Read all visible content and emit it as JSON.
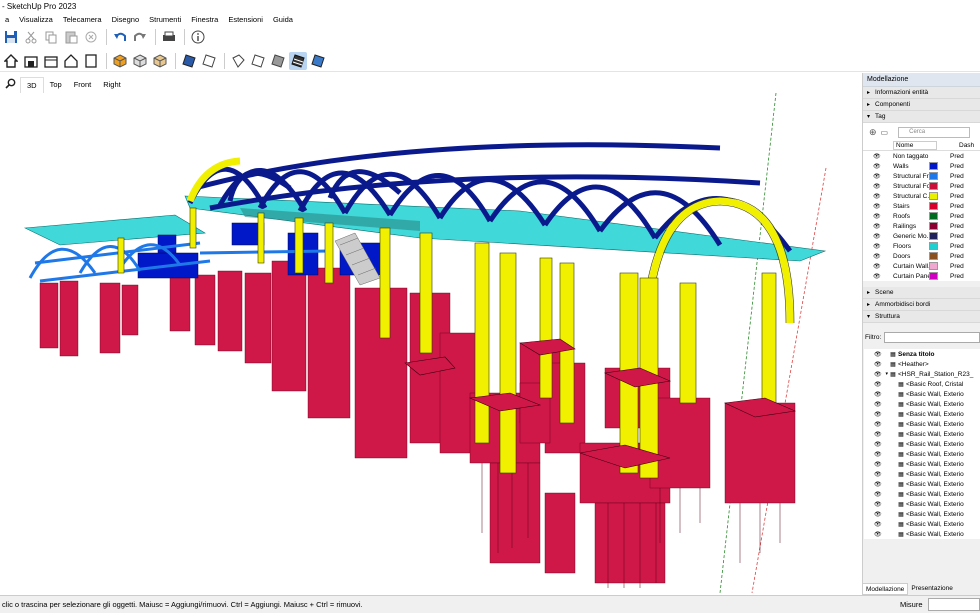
{
  "window": {
    "title": "- SketchUp Pro 2023"
  },
  "menu": [
    "a",
    "Visualizza",
    "Telecamera",
    "Disegno",
    "Strumenti",
    "Finestra",
    "Estensioni",
    "Guida"
  ],
  "toolbar1": [
    "save-icon",
    "cut-icon",
    "copy-icon",
    "paste-icon",
    "erase-icon",
    "undo-icon",
    "redo-icon",
    "print-icon",
    "info-icon"
  ],
  "toolbar2": [
    "home-icon",
    "warehouse-icon",
    "extension-warehouse-icon",
    "house-icon",
    "page-icon",
    "iso-view-icon",
    "xray-view-icon",
    "back-edges-icon",
    "wireframe-icon",
    "hidden-line-icon",
    "shaded-icon",
    "shaded-textures-icon",
    "monochrome-icon",
    "style-a-icon",
    "style-b-icon",
    "style-c-icon",
    "style-d-icon"
  ],
  "view_tabs": {
    "zoom_icon": "search-icon",
    "tabs": [
      "3D",
      "Top",
      "Front",
      "Right"
    ],
    "active": "3D"
  },
  "panel": {
    "title": "Modellazione",
    "sections": {
      "entity_info": "Informazioni entità",
      "components": "Componenti",
      "tags": "Tag",
      "scenes": "Scene",
      "soften": "Ammorbidisci bordi",
      "outliner": "Struttura"
    },
    "tag_search_placeholder": "Cerca",
    "tag_columns": {
      "name": "Nome",
      "dash": "Dash"
    },
    "tags": [
      {
        "name": "Non taggato",
        "color": "",
        "dash": "Pred"
      },
      {
        "name": "Walls",
        "color": "#0018c8",
        "dash": "Pred"
      },
      {
        "name": "Structural Fr...",
        "color": "#1f78e8",
        "dash": "Pred"
      },
      {
        "name": "Structural Fo...",
        "color": "#c8103a",
        "dash": "Pred"
      },
      {
        "name": "Structural C...",
        "color": "#e8f000",
        "dash": "Pred"
      },
      {
        "name": "Stairs",
        "color": "#d8002a",
        "dash": "Pred"
      },
      {
        "name": "Roofs",
        "color": "#006b20",
        "dash": "Pred"
      },
      {
        "name": "Railings",
        "color": "#8a0030",
        "dash": "Pred"
      },
      {
        "name": "Generic Mo...",
        "color": "#20205a",
        "dash": "Pred"
      },
      {
        "name": "Floors",
        "color": "#20d0d0",
        "dash": "Pred"
      },
      {
        "name": "Doors",
        "color": "#8a5020",
        "dash": "Pred"
      },
      {
        "name": "Curtain Wall...",
        "color": "#f0a8d0",
        "dash": "Pred"
      },
      {
        "name": "Curtain Panels",
        "color": "#d000c0",
        "dash": "Pred"
      }
    ],
    "filter_label": "Filtro:",
    "outliner": [
      {
        "label": "Senza titolo",
        "level": 0,
        "bold": true
      },
      {
        "label": "<Heather>",
        "level": 1
      },
      {
        "label": "<HSR_Rail_Station_R23_",
        "level": 1
      },
      {
        "label": "<Basic Roof, Cristal",
        "level": 2
      },
      {
        "label": "<Basic Wall, Exterio",
        "level": 2
      },
      {
        "label": "<Basic Wall, Exterio",
        "level": 2
      },
      {
        "label": "<Basic Wall, Exterio",
        "level": 2
      },
      {
        "label": "<Basic Wall, Exterio",
        "level": 2
      },
      {
        "label": "<Basic Wall, Exterio",
        "level": 2
      },
      {
        "label": "<Basic Wall, Exterio",
        "level": 2
      },
      {
        "label": "<Basic Wall, Exterio",
        "level": 2
      },
      {
        "label": "<Basic Wall, Exterio",
        "level": 2
      },
      {
        "label": "<Basic Wall, Exterio",
        "level": 2
      },
      {
        "label": "<Basic Wall, Exterio",
        "level": 2
      },
      {
        "label": "<Basic Wall, Exterio",
        "level": 2
      },
      {
        "label": "<Basic Wall, Exterio",
        "level": 2
      },
      {
        "label": "<Basic Wall, Exterio",
        "level": 2
      },
      {
        "label": "<Basic Wall, Exterio",
        "level": 2
      },
      {
        "label": "<Basic Wall, Exterio",
        "level": 2
      }
    ],
    "bottom_tabs": [
      "Modellazione",
      "Presentazione"
    ]
  },
  "status": {
    "message": "clic o trascina per selezionare gli oggetti. Maiusc = Aggiungi/rimuovi. Ctrl = Aggiungi. Maiusc + Ctrl = rimuovi.",
    "measure_label": "Misure"
  },
  "colors": {
    "roof_arch": "#0a1a8c",
    "yellow_column": "#f0f000",
    "pile": "#d01848",
    "floor": "#40d8d8"
  }
}
